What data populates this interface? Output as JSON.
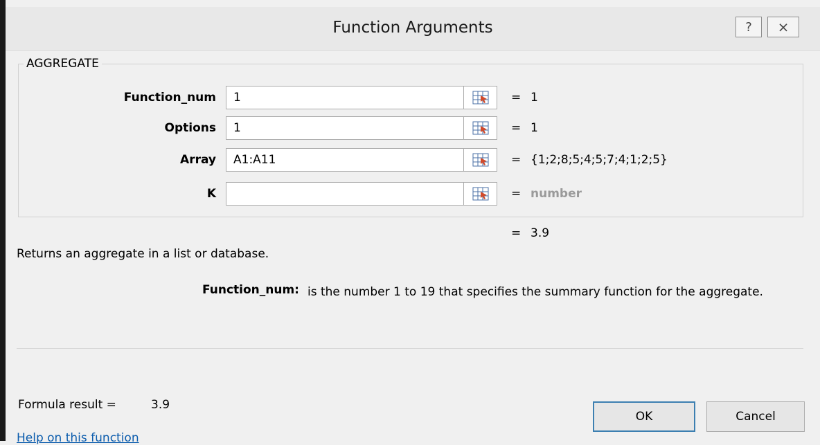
{
  "window": {
    "title": "Function Arguments",
    "help_glyph": "?",
    "close_glyph": "⨯"
  },
  "group": {
    "label": "AGGREGATE"
  },
  "args": [
    {
      "label": "Function_num",
      "value": "1",
      "result": "1"
    },
    {
      "label": "Options",
      "value": "1",
      "result": "1"
    },
    {
      "label": "Array",
      "value": "A1:A11",
      "result": "{1;2;8;5;4;5;7;4;1;2;5}"
    },
    {
      "label": "K",
      "value": "",
      "result": "number"
    }
  ],
  "equals_sign": "=",
  "overall_result": "3.9",
  "description": "Returns an aggregate in a list or database.",
  "arg_help": {
    "name": "Function_num:",
    "text": "is the number 1 to 19 that specifies the summary function for the aggregate."
  },
  "formula_result": {
    "label": "Formula result =",
    "value": "3.9"
  },
  "help_link": "Help on this function",
  "buttons": {
    "ok": "OK",
    "cancel": "Cancel"
  },
  "icons": {
    "help": "help-icon",
    "close": "close-icon",
    "ref": "range-select-icon"
  },
  "colors": {
    "link": "#0b5cad",
    "ok_border": "#3c7fb1",
    "placeholder": "#9a9a9a"
  }
}
